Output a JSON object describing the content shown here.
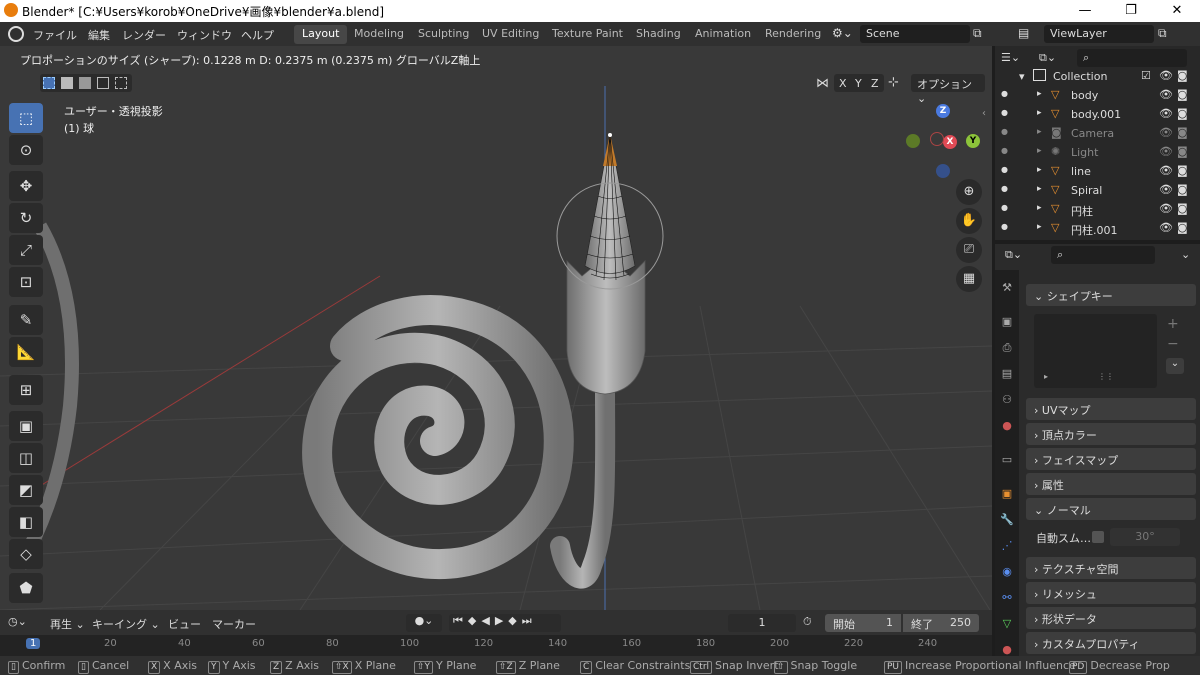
{
  "window": {
    "title": "Blender* [C:¥Users¥korob¥OneDrive¥画像¥blender¥a.blend]",
    "minimize": "—",
    "restore": "❐",
    "close": "✕"
  },
  "menus": [
    "ファイル",
    "編集",
    "レンダー",
    "ウィンドウ",
    "ヘルプ"
  ],
  "workspaces": [
    {
      "label": "Layout",
      "active": true
    },
    {
      "label": "Modeling"
    },
    {
      "label": "Sculpting"
    },
    {
      "label": "UV Editing"
    },
    {
      "label": "Texture Paint"
    },
    {
      "label": "Shading"
    },
    {
      "label": "Animation"
    },
    {
      "label": "Rendering"
    }
  ],
  "scene": "Scene",
  "view_layer": "ViewLayer",
  "operator_header": "プロポーションのサイズ (シャープ): 0.1228 m   D: 0.2375 m (0.2375 m) グローバルZ軸上",
  "viewport": {
    "view_label": "ユーザー・透視投影",
    "object_label": "(1) 球",
    "axes": [
      "X",
      "Y",
      "Z"
    ],
    "options": "オプション",
    "gizmo": {
      "z": "Z",
      "x": "X",
      "y": "Y"
    },
    "tools": [
      "select-box",
      "cursor",
      "move",
      "rotate",
      "scale",
      "transform",
      "annotate",
      "measure",
      "add-cube",
      "extrude",
      "inset",
      "bevel",
      "loop-cut",
      "knife",
      "poly-build"
    ]
  },
  "outliner": {
    "collection": "Collection",
    "items": [
      {
        "name": "body",
        "dim": false
      },
      {
        "name": "body.001",
        "dim": false
      },
      {
        "name": "Camera",
        "dim": true
      },
      {
        "name": "Light",
        "dim": true
      },
      {
        "name": "line",
        "dim": false
      },
      {
        "name": "Spiral",
        "dim": false
      },
      {
        "name": "円柱",
        "dim": false
      },
      {
        "name": "円柱.001",
        "dim": false
      }
    ]
  },
  "properties": {
    "shape_keys": "シェイプキー",
    "panels": [
      "UVマップ",
      "頂点カラー",
      "フェイスマップ",
      "属性"
    ],
    "normal": "ノーマル",
    "auto_smooth_label": "自動スム…",
    "auto_smooth_angle": "30°",
    "panels2": [
      "テクスチャ空間",
      "リメッシュ",
      "形状データ",
      "カスタムプロパティ"
    ]
  },
  "timeline": {
    "playback": "再生",
    "keying": "キーイング",
    "view": "ビュー",
    "marker": "マーカー",
    "current_frame": "1",
    "start_label": "開始",
    "start": "1",
    "end_label": "終了",
    "end": "250",
    "ticks": [
      "1",
      "20",
      "40",
      "60",
      "80",
      "100",
      "120",
      "140",
      "160",
      "180",
      "200",
      "220",
      "240"
    ]
  },
  "status": [
    {
      "key": "",
      "label": "Confirm"
    },
    {
      "key": "",
      "label": "Cancel"
    },
    {
      "key": "X",
      "label": "X Axis"
    },
    {
      "key": "Y",
      "label": "Y Axis"
    },
    {
      "key": "Z",
      "label": "Z Axis"
    },
    {
      "key": "⇧X",
      "label": "X Plane"
    },
    {
      "key": "⇧Y",
      "label": "Y Plane"
    },
    {
      "key": "⇧Z",
      "label": "Z Plane"
    },
    {
      "key": "C",
      "label": "Clear Constraints"
    },
    {
      "key": "Ctrl",
      "label": "Snap Invert"
    },
    {
      "key": "⇧",
      "label": "Snap Toggle"
    },
    {
      "key": "PU",
      "label": "Increase Proportional Influence"
    },
    {
      "key": "PD",
      "label": "Decrease Prop"
    }
  ]
}
